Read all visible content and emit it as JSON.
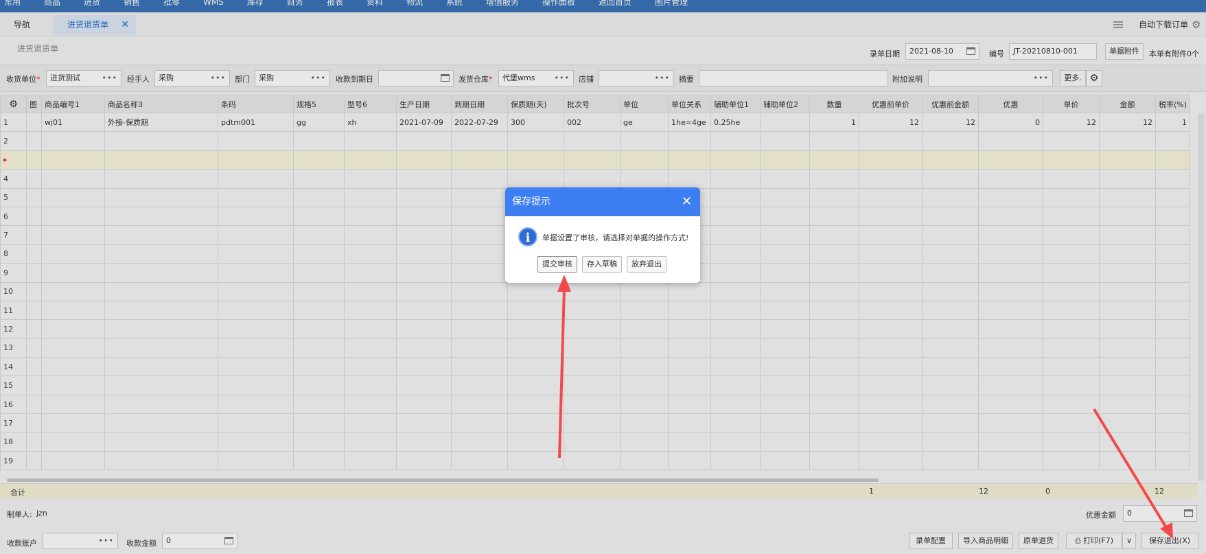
{
  "topbar": {
    "menus": [
      "常用",
      "商品",
      "进货",
      "销售",
      "批零",
      "WMS",
      "库存",
      "财务",
      "报表",
      "资料",
      "物流",
      "系统",
      "增值服务",
      "操作面板",
      "返回首页",
      "图片管理"
    ]
  },
  "tabs": {
    "nav": "导航",
    "active": "进货退货单",
    "close": "✕",
    "auto_download": "自动下载订单"
  },
  "page": {
    "title": "进货退货单"
  },
  "header": {
    "record_date_label": "录单日期",
    "record_date": "2021-08-10",
    "number_label": "编号",
    "number": "JT-20210810-001",
    "attach_button": "单据附件",
    "attach_info": "本单有附件0个"
  },
  "filters": {
    "receiver_label": "收货单位",
    "receiver": "进货测试",
    "handler_label": "经手人",
    "handler": "采购",
    "dept_label": "部门",
    "dept": "采购",
    "due_label": "收款到期日",
    "due": "",
    "warehouse_label": "发货仓库",
    "warehouse": "代堡wms",
    "store_label": "店铺",
    "store": "",
    "summary_label": "摘要",
    "summary": "",
    "note_label": "附加说明",
    "note": "",
    "more_button": "更多."
  },
  "grid": {
    "columns": [
      "",
      "图",
      "商品编号1",
      "商品名称3",
      "条码",
      "规格5",
      "型号6",
      "生产日期",
      "到期日期",
      "保质期(天)",
      "批次号",
      "单位",
      "单位关系",
      "辅助单位1",
      "辅助单位2",
      "数量",
      "优惠前单价",
      "优惠前金额",
      "优惠",
      "单价",
      "金额",
      "税率(%)"
    ],
    "row1": [
      "1",
      "",
      "wj01",
      "外接-保质期",
      "pdtm001",
      "gg",
      "xh",
      "2021-07-09",
      "2022-07-29",
      "300",
      "002",
      "ge",
      "1he=4ge",
      "0.25he",
      "",
      "1",
      "12",
      "12",
      "0",
      "12",
      "12",
      "1"
    ],
    "row_numbers": [
      "2",
      "▸",
      "4",
      "5",
      "6",
      "7",
      "8",
      "9",
      "10",
      "11",
      "12",
      "13",
      "14",
      "15",
      "16",
      "17",
      "18",
      "19"
    ]
  },
  "totals": {
    "label": "合计",
    "qty": "1",
    "pre_amount": "12",
    "discount": "0",
    "amount": "12"
  },
  "footer": {
    "creator_label": "制单人:",
    "creator": "jzn",
    "discount_amount_label": "优惠金额",
    "discount_amount": "0",
    "account_label": "收款账户",
    "account": "",
    "receive_amount_label": "收款金额",
    "receive_amount": "0",
    "buttons": {
      "config": "录单配置",
      "import": "导入商品明细",
      "original": "原单退货",
      "print": "打印(F7)",
      "save_exit": "保存退出(X)"
    }
  },
  "dialog": {
    "title": "保存提示",
    "close": "✕",
    "icon": "i",
    "message": "单据设置了审核，请选择对单据的操作方式!",
    "submit": "提交审核",
    "draft": "存入草稿",
    "abandon": "放弃退出"
  },
  "colors": {
    "accent": "#3d7ef2",
    "topbar": "#3a73b8",
    "arrow": "#f24a4a",
    "highlight_row": "#fbf6dc"
  }
}
